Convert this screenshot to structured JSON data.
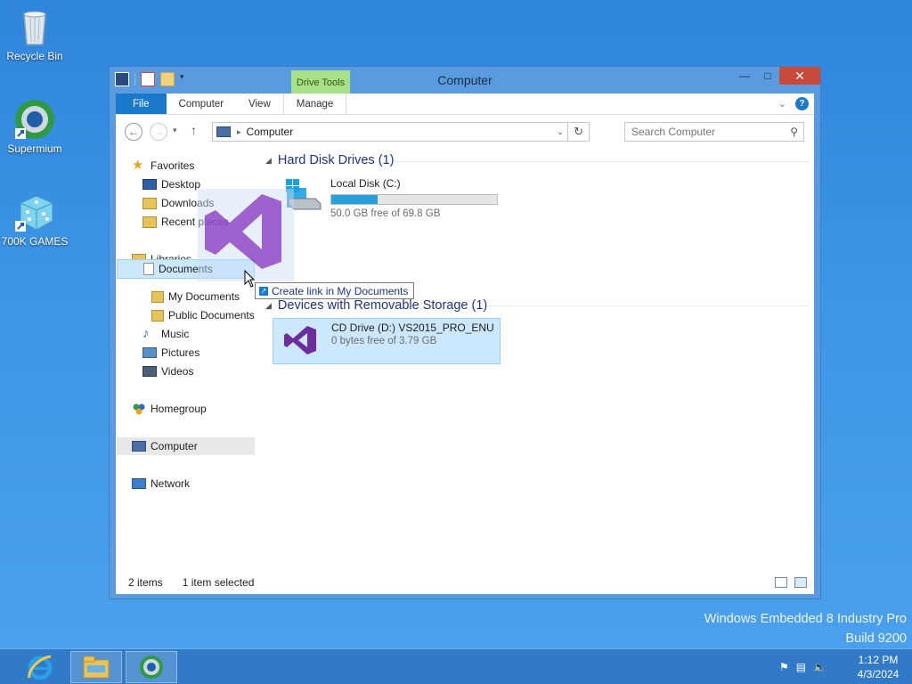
{
  "desktop": {
    "icons": [
      {
        "label": "Recycle Bin",
        "icon": "recycle-bin-icon"
      },
      {
        "label": "Supermium",
        "icon": "supermium-icon"
      },
      {
        "label": "700K GAMES",
        "icon": "dice-icon"
      }
    ],
    "watermark_line1": "Windows Embedded 8 Industry Pro",
    "watermark_line2": "Build 9200"
  },
  "window": {
    "title": "Computer",
    "contextual_tab_group": "Drive Tools",
    "tabs": [
      "File",
      "Computer",
      "View",
      "Manage"
    ],
    "address": "Computer",
    "search_placeholder": "Search Computer"
  },
  "navpane": {
    "items": [
      {
        "label": "Favorites",
        "icon": "star-icon"
      },
      {
        "label": "Desktop",
        "icon": "desktop-icon"
      },
      {
        "label": "Downloads",
        "icon": "downloads-icon"
      },
      {
        "label": "Recent places",
        "icon": "recent-places-icon"
      },
      {
        "label": "Libraries",
        "icon": "libraries-icon"
      },
      {
        "label": "Documents",
        "icon": "documents-icon"
      },
      {
        "label": "My Documents",
        "icon": "folder-icon"
      },
      {
        "label": "Public Documents",
        "icon": "folder-icon"
      },
      {
        "label": "Music",
        "icon": "music-icon"
      },
      {
        "label": "Pictures",
        "icon": "pictures-icon"
      },
      {
        "label": "Videos",
        "icon": "videos-icon"
      },
      {
        "label": "Homegroup",
        "icon": "homegroup-icon"
      },
      {
        "label": "Computer",
        "icon": "computer-icon"
      },
      {
        "label": "Network",
        "icon": "network-icon"
      }
    ]
  },
  "main": {
    "groups": [
      {
        "title": "Hard Disk Drives (1)"
      },
      {
        "title": "Devices with Removable Storage (1)"
      }
    ],
    "drives": [
      {
        "name": "Local Disk (C:)",
        "free": "50.0 GB free of 69.8 GB",
        "used_fraction": 0.28
      },
      {
        "name": "CD Drive (D:) VS2015_PRO_ENU",
        "free": "0 bytes free of 3.79 GB"
      }
    ]
  },
  "drag": {
    "tooltip": "Create link in My Documents"
  },
  "status": {
    "items": "2 items",
    "selected": "1 item selected"
  },
  "taskbar": {
    "time": "1:12 PM",
    "date": "4/3/2024"
  },
  "colors": {
    "accent": "#1979ca",
    "selection": "#cce8ff",
    "drive_tools": "#a8e087",
    "close": "#c74a3a"
  }
}
